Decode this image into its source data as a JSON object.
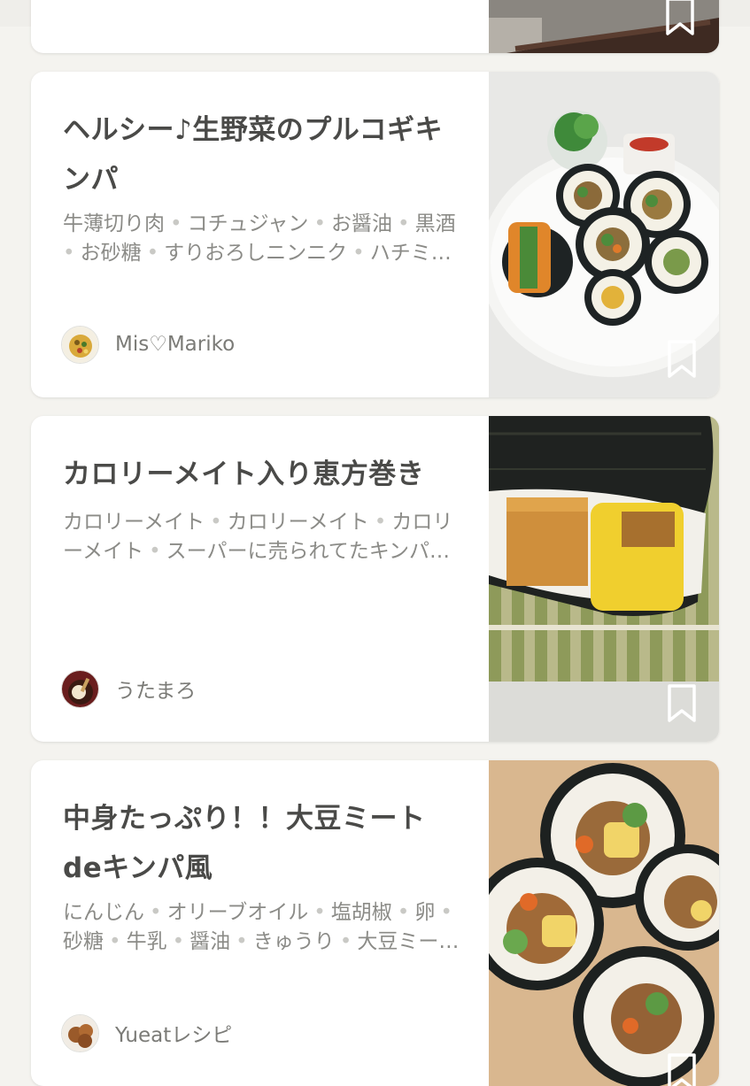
{
  "cards": [
    {
      "title_lines": [
        "ヘルシー♪生野菜のプルコギキ",
        "ンパ"
      ],
      "ingredient_lines": [
        [
          "牛薄切り肉",
          "コチュジャン",
          "お醤油",
          "黒酒"
        ],
        [
          "お砂糖",
          "すりおろしニンニク",
          "ハチミ…"
        ]
      ],
      "author": "Mis♡Mariko"
    },
    {
      "title_lines": [
        "カロリーメイト入り恵方巻き"
      ],
      "ingredient_lines": [
        [
          "カロリーメイト",
          "カロリーメイト",
          "カロリ"
        ],
        [
          "ーメイト",
          "スーパーに売られてたキンパ…"
        ]
      ],
      "author": "うたまろ"
    },
    {
      "title_lines": [
        "中身たっぷり！！大豆ミート",
        "deキンパ風"
      ],
      "ingredient_lines": [
        [
          "にんじん",
          "オリーブオイル",
          "塩胡椒",
          "卵"
        ],
        [
          "砂糖",
          "牛乳",
          "醤油",
          "きゅうり",
          "大豆ミー…"
        ]
      ],
      "author": "Yueatレシピ"
    }
  ],
  "icons": {
    "bookmark": "bookmark-icon",
    "avatar": "avatar"
  },
  "colors": {
    "background": "#f4f3ef",
    "card": "#ffffff",
    "title": "#4a4a48",
    "ingredients": "#8b8b87"
  }
}
